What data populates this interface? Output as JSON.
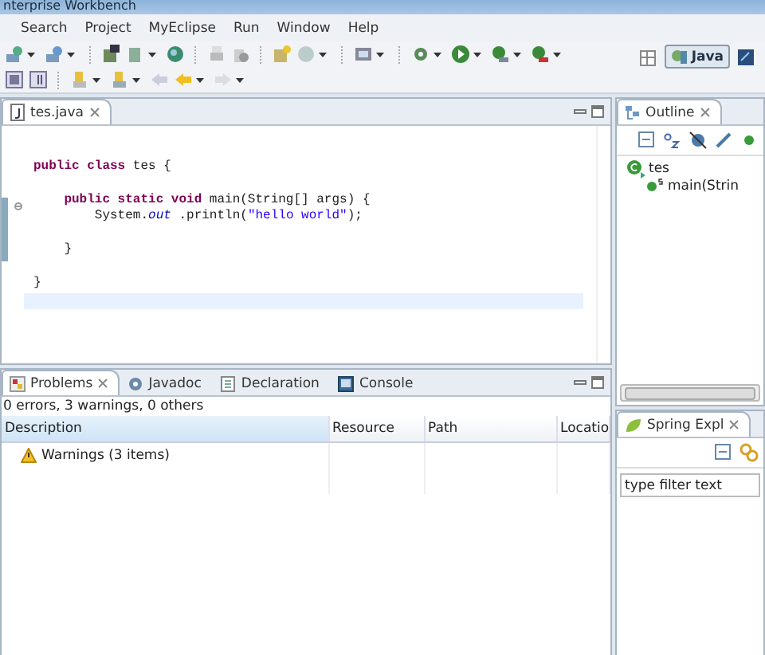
{
  "window": {
    "title": "nterprise Workbench"
  },
  "menu": [
    "Search",
    "Project",
    "MyEclipse",
    "Run",
    "Window",
    "Help"
  ],
  "perspectives": [
    {
      "label": "Java",
      "selected": true
    }
  ],
  "editor": {
    "tabs": [
      {
        "label": "tes.java",
        "selected": true
      }
    ],
    "lines": [
      {
        "kind": "blank"
      },
      {
        "kind": "code",
        "tokens": [
          {
            "text": "public class ",
            "kind": "keyword"
          },
          {
            "text": "tes {",
            "kind": "plain"
          }
        ]
      },
      {
        "kind": "blank"
      },
      {
        "kind": "code",
        "tokens": [
          {
            "text": "    public static void ",
            "kind": "keyword"
          },
          {
            "text": "main(String[] args) {",
            "kind": "plain"
          }
        ]
      },
      {
        "kind": "code",
        "tokens": [
          {
            "text": "        System.",
            "kind": "plain"
          },
          {
            "text": "out",
            "kind": "field"
          },
          {
            "text": " .println(",
            "kind": "plain"
          },
          {
            "text": "\"hello world\"",
            "kind": "string"
          },
          {
            "text": ");",
            "kind": "plain"
          }
        ]
      },
      {
        "kind": "blank"
      },
      {
        "kind": "code",
        "tokens": [
          {
            "text": "    }",
            "kind": "plain"
          }
        ]
      },
      {
        "kind": "blank"
      },
      {
        "kind": "code",
        "tokens": [
          {
            "text": "}",
            "kind": "plain"
          }
        ]
      }
    ]
  },
  "outline": {
    "tab": {
      "label": "Outline",
      "selected": true
    },
    "tree": [
      {
        "label": "tes",
        "kind": "class",
        "children": [
          {
            "label": "main(Strin",
            "kind": "method"
          }
        ]
      }
    ]
  },
  "problems": {
    "tabs": [
      {
        "label": "Problems",
        "selected": true
      },
      {
        "label": "Javadoc",
        "selected": false
      },
      {
        "label": "Declaration",
        "selected": false
      },
      {
        "label": "Console",
        "selected": false
      }
    ],
    "summary": "0 errors, 3 warnings, 0 others",
    "columns": [
      "Description",
      "Resource",
      "Path",
      "Locatio"
    ],
    "rows": [
      {
        "description": "Warnings (3 items)"
      }
    ]
  },
  "spring": {
    "tab": {
      "label": "Spring Expl",
      "selected": true
    },
    "filter": {
      "placeholder": "type filter text"
    }
  }
}
